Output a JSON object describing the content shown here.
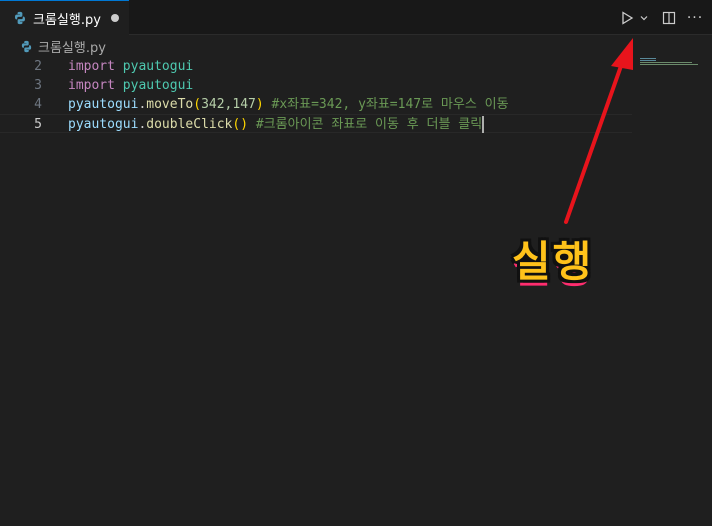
{
  "tab": {
    "title": "크롬실행.py"
  },
  "breadcrumb": {
    "file": "크롬실행.py"
  },
  "actions": {
    "run": "run-icon",
    "more": "···"
  },
  "editor": {
    "lines": [
      {
        "num": "2",
        "tokens": [
          "import",
          "pyautogui"
        ]
      },
      {
        "num": "3",
        "tokens": [
          "import",
          "pyautogui"
        ]
      },
      {
        "num": "4",
        "tokens": [
          "pyautogui",
          ".",
          "moveTo",
          "(",
          "342,147",
          ")",
          "#x좌표=342, y좌표=147로 마우스 이동"
        ]
      },
      {
        "num": "5",
        "tokens": [
          "pyautogui",
          ".",
          "doubleClick",
          "(",
          ")",
          "#크롬아이콘 좌표로 이동 후 더블 클릭"
        ]
      }
    ]
  },
  "annotation": {
    "text": "실행"
  },
  "colors": {
    "arrow": "#e8141c",
    "annotation_fill": "#ffc21a",
    "annotation_shadow": "#ff2d6f"
  }
}
